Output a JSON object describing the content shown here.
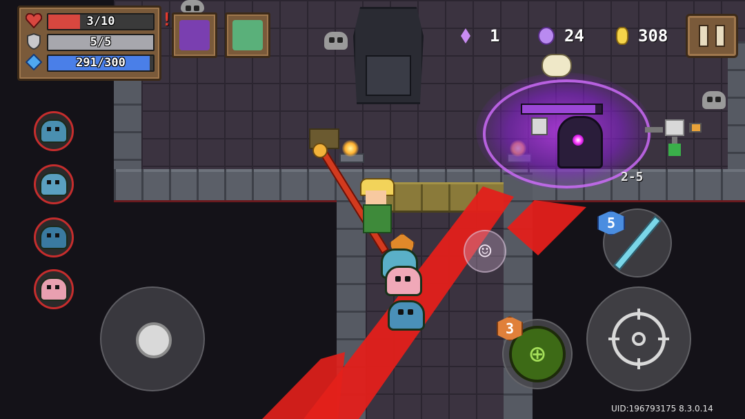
{
  "hud": {
    "health": {
      "current": 3,
      "max": 10,
      "text": "3/10",
      "color": "#d8473f"
    },
    "armor": {
      "current": 5,
      "max": 5,
      "text": "5/5",
      "color": "#a7a7ad"
    },
    "energy": {
      "current": 291,
      "max": 300,
      "text": "291/300",
      "color": "#4a7fe8"
    },
    "alert_mark": "!",
    "buffs": [
      {
        "icon": "purple-orb-buff-icon",
        "color": "#7a3fb0"
      },
      {
        "icon": "green-dragon-buff-icon",
        "color": "#5ab07a"
      }
    ]
  },
  "currencies": {
    "purple_gems": "1",
    "purple_coins": "24",
    "gold": "308"
  },
  "level": "2-5",
  "party": [
    {
      "icon": "blue-slime-pet-icon",
      "color": "#4a8fb0"
    },
    {
      "icon": "goggles-pet-icon",
      "color": "#5aa0c0"
    },
    {
      "icon": "sparkle-pet-icon",
      "color": "#3a7aa0"
    },
    {
      "icon": "pink-pet-icon",
      "color": "#e8a0b0"
    }
  ],
  "controls": {
    "emote": "☺",
    "weapon_ammo": "5",
    "skill_charges": "3"
  },
  "uid_text": "UID:196793175 8.3.0.14",
  "colors": {
    "laser": "#e3201b",
    "aura": "#a030e0",
    "panel": "#7a5a3a"
  }
}
